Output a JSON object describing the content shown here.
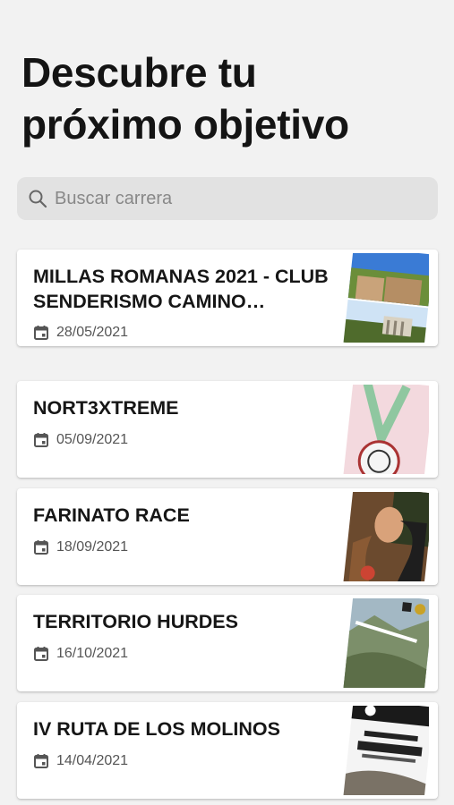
{
  "page": {
    "title_line1": "Descubre tu",
    "title_line2": "próximo objetivo"
  },
  "search": {
    "placeholder": "Buscar carrera",
    "value": ""
  },
  "races": [
    {
      "name": "MILLAS ROMANAS 2021 - CLUB SENDERISMO CAMINO…",
      "date": "28/05/2021",
      "image": "photo-collage-ruins"
    },
    {
      "name": "NORT3XTREME",
      "date": "05/09/2021",
      "image": "medal-drawing"
    },
    {
      "name": "FARINATO RACE",
      "date": "18/09/2021",
      "image": "mud-runner-photo"
    },
    {
      "name": "TERRITORIO HURDES",
      "date": "16/10/2021",
      "image": "valley-poster"
    },
    {
      "name": "IV RUTA DE LOS MOLINOS",
      "date": "14/04/2021",
      "image": "molinos-poster"
    }
  ],
  "icons": {
    "search": "search-icon",
    "date": "calendar-icon"
  },
  "colors": {
    "background": "#f2f2f2",
    "card": "#ffffff",
    "search_bg": "#e2e2e2"
  }
}
